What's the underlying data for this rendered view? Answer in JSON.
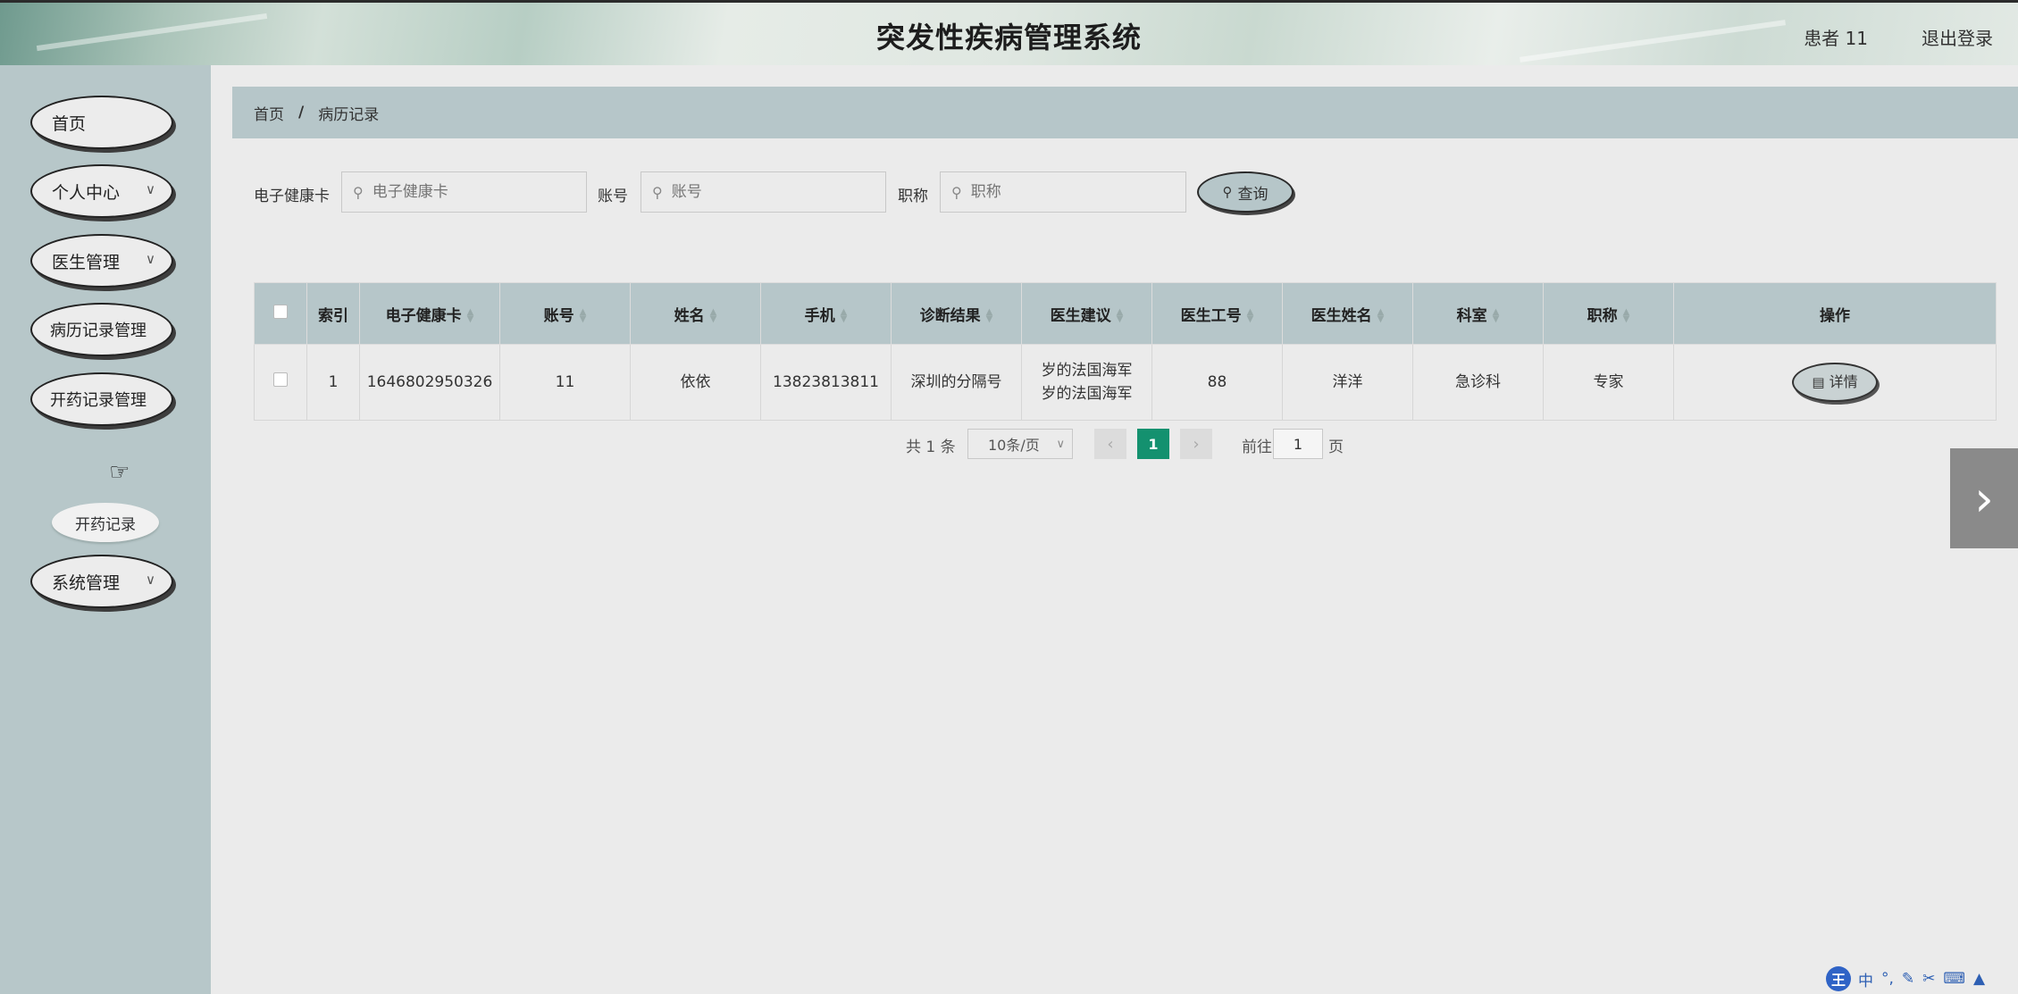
{
  "header": {
    "title": "突发性疾病管理系统",
    "user": "患者 11",
    "logout": "退出登录"
  },
  "sidebar": {
    "items": [
      {
        "label": "首页",
        "has_sub": false
      },
      {
        "label": "个人中心",
        "has_sub": true
      },
      {
        "label": "医生管理",
        "has_sub": true
      },
      {
        "label": "病历记录管理",
        "has_sub": false
      },
      {
        "label": "开药记录管理",
        "has_sub": false
      },
      {
        "label": "系统管理",
        "has_sub": true
      }
    ],
    "active_sub": "开药记录"
  },
  "breadcrumb": {
    "home": "首页",
    "separator": "/",
    "current": "病历记录"
  },
  "search": {
    "fields": [
      {
        "label": "电子健康卡",
        "placeholder": "电子健康卡",
        "value": ""
      },
      {
        "label": "账号",
        "placeholder": "账号",
        "value": ""
      },
      {
        "label": "职称",
        "placeholder": "职称",
        "value": ""
      }
    ],
    "button": "查询"
  },
  "table": {
    "headers": [
      "索引",
      "电子健康卡",
      "账号",
      "姓名",
      "手机",
      "诊断结果",
      "医生建议",
      "医生工号",
      "医生姓名",
      "科室",
      "职称",
      "操作"
    ],
    "rows": [
      {
        "index": "1",
        "card": "1646802950326",
        "account": "11",
        "name": "依依",
        "phone": "13823813811",
        "diagnosis": "深圳的分隔号",
        "advice": "岁的法国海军岁的法国海军",
        "doctor_id": "88",
        "doctor_name": "洋洋",
        "department": "急诊科",
        "title": "专家",
        "action": "详情"
      }
    ]
  },
  "pagination": {
    "total": "共 1 条",
    "page_size": "10条/页",
    "current_page": "1",
    "goto_label": "前往",
    "goto_value": "1",
    "page_suffix": "页"
  },
  "ime": {
    "logo": "王",
    "mode": "中"
  },
  "colors": {
    "accent": "#14916f",
    "panel": "#b6c6c9",
    "background": "#ebebeb"
  }
}
